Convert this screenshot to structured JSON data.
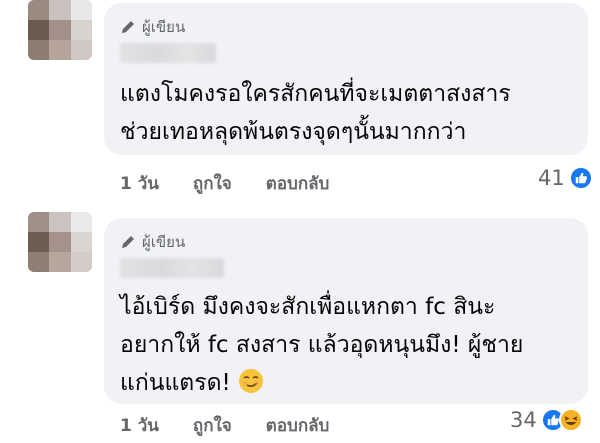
{
  "comments": [
    {
      "author_badge": "ผู้เขียน",
      "text_lines": [
        "แตงโมคงรอใครสักคนที่จะเมตตาสงสาร",
        "ช่วยเทอหลุดพ้นตรงจุดๆนั้นมากกว่า"
      ],
      "time": "1 วัน",
      "like_label": "ถูกใจ",
      "reply_label": "ตอบกลับ",
      "reaction_count": "41",
      "reactions": [
        "like-icon"
      ]
    },
    {
      "author_badge": "ผู้เขียน",
      "text_lines": [
        "ไอ้เบิร์ด มึงคงจะสักเพื่อแหกตา fc สินะ",
        "อยากให้ fc สงสาร แล้วอุดหนุนมึง! ผู้ชาย",
        "แก่นแตรด!"
      ],
      "emoji": "smirking-face",
      "time": "1 วัน",
      "like_label": "ถูกใจ",
      "reply_label": "ตอบกลับ",
      "reaction_count": "34",
      "reactions": [
        "like-icon",
        "haha-icon"
      ]
    }
  ],
  "colors": {
    "bubble": "#f0f2f5",
    "muted": "#65676b",
    "like_blue": "#1877f2",
    "haha_yellow": "#f7b125"
  }
}
